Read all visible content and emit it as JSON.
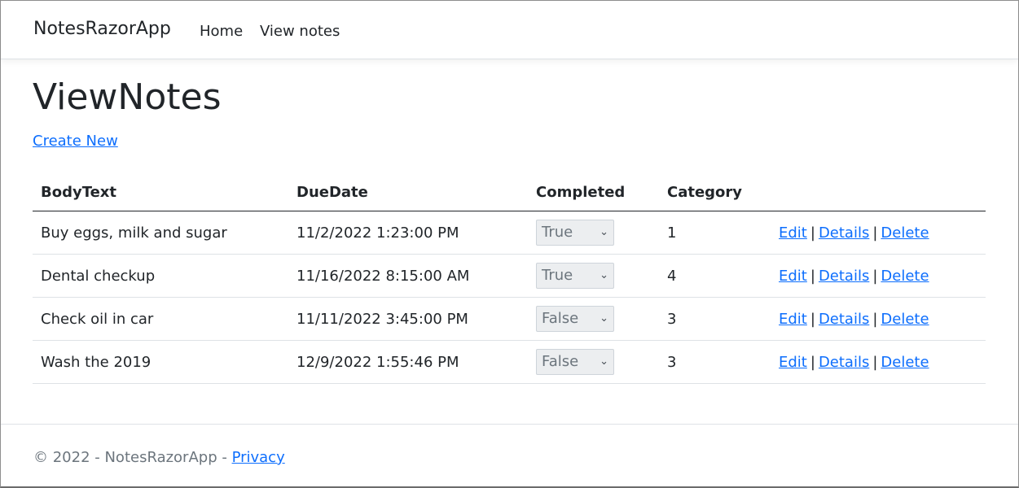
{
  "navbar": {
    "brand": "NotesRazorApp",
    "links": [
      "Home",
      "View notes"
    ]
  },
  "page": {
    "title": "ViewNotes",
    "create_link": "Create New"
  },
  "table": {
    "headers": [
      "BodyText",
      "DueDate",
      "Completed",
      "Category",
      ""
    ],
    "rows": [
      {
        "body": "Buy eggs, milk and sugar",
        "due": "11/2/2022 1:23:00 PM",
        "completed": "True",
        "category": "1"
      },
      {
        "body": "Dental checkup",
        "due": "11/16/2022 8:15:00 AM",
        "completed": "True",
        "category": "4"
      },
      {
        "body": "Check oil in car",
        "due": "11/11/2022 3:45:00 PM",
        "completed": "False",
        "category": "3"
      },
      {
        "body": "Wash the 2019",
        "due": "12/9/2022 1:55:46 PM",
        "completed": "False",
        "category": "3"
      }
    ],
    "actions": [
      "Edit",
      "Details",
      "Delete"
    ],
    "separator": "|"
  },
  "footer": {
    "text": "© 2022 - NotesRazorApp - ",
    "privacy": "Privacy"
  },
  "colors": {
    "link": "#0d6efd",
    "text": "#212529",
    "muted": "#6c757d"
  }
}
